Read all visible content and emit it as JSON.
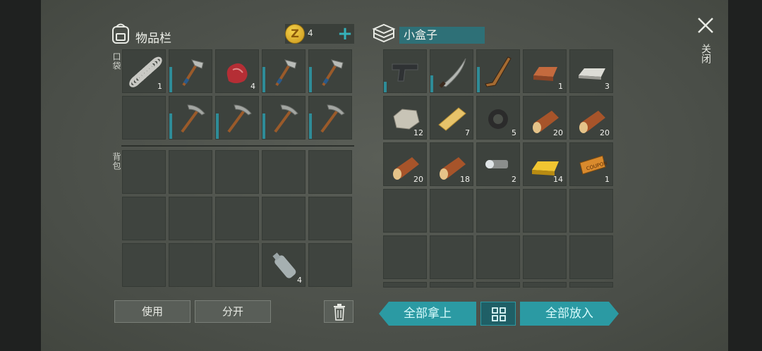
{
  "inventory": {
    "title": "物品栏",
    "pocket_label": "口袋",
    "backpack_label": "背包",
    "coins": "4",
    "pocket": [
      {
        "icon": "spring-icon",
        "qty": "1",
        "dur": 0
      },
      {
        "icon": "hammer-icon",
        "qty": "",
        "dur": 0.6
      },
      {
        "icon": "meat-icon",
        "qty": "4",
        "dur": 0
      },
      {
        "icon": "hammer-icon",
        "qty": "",
        "dur": 0.6
      },
      {
        "icon": "hammer-icon",
        "qty": "",
        "dur": 0.6
      },
      {
        "icon": "",
        "qty": "",
        "dur": 0
      },
      {
        "icon": "pickaxe-icon",
        "qty": "",
        "dur": 0.6
      },
      {
        "icon": "pickaxe-icon",
        "qty": "",
        "dur": 0.6
      },
      {
        "icon": "pickaxe-icon",
        "qty": "",
        "dur": 0.6
      },
      {
        "icon": "pickaxe-icon",
        "qty": "",
        "dur": 0.6
      }
    ],
    "backpack": [
      {
        "icon": "",
        "qty": ""
      },
      {
        "icon": "",
        "qty": ""
      },
      {
        "icon": "",
        "qty": ""
      },
      {
        "icon": "",
        "qty": ""
      },
      {
        "icon": "",
        "qty": ""
      },
      {
        "icon": "",
        "qty": ""
      },
      {
        "icon": "",
        "qty": ""
      },
      {
        "icon": "",
        "qty": ""
      },
      {
        "icon": "",
        "qty": ""
      },
      {
        "icon": "",
        "qty": ""
      },
      {
        "icon": "",
        "qty": ""
      },
      {
        "icon": "",
        "qty": ""
      },
      {
        "icon": "",
        "qty": ""
      },
      {
        "icon": "bottle-icon",
        "qty": "4"
      },
      {
        "icon": "",
        "qty": ""
      }
    ],
    "use_label": "使用",
    "split_label": "分开"
  },
  "container": {
    "name": "小盒子",
    "items": [
      {
        "icon": "pistol-icon",
        "qty": "",
        "dur": 0.25
      },
      {
        "icon": "machete-icon",
        "qty": "",
        "dur": 0.4
      },
      {
        "icon": "hockey-stick-icon",
        "qty": "",
        "dur": 0.6
      },
      {
        "icon": "copper-ingot-icon",
        "qty": "1",
        "dur": 0
      },
      {
        "icon": "silver-ingot-icon",
        "qty": "3",
        "dur": 0
      },
      {
        "icon": "stone-icon",
        "qty": "12",
        "dur": 0
      },
      {
        "icon": "plank-icon",
        "qty": "7",
        "dur": 0
      },
      {
        "icon": "rubber-parts-icon",
        "qty": "5",
        "dur": 0
      },
      {
        "icon": "log-icon",
        "qty": "20",
        "dur": 0
      },
      {
        "icon": "log-icon",
        "qty": "20",
        "dur": 0
      },
      {
        "icon": "log-icon",
        "qty": "20",
        "dur": 0
      },
      {
        "icon": "log-icon",
        "qty": "18",
        "dur": 0
      },
      {
        "icon": "flashlight-icon",
        "qty": "2",
        "dur": 0
      },
      {
        "icon": "gold-ingot-icon",
        "qty": "14",
        "dur": 0
      },
      {
        "icon": "coupon-icon",
        "qty": "1",
        "dur": 0
      }
    ],
    "take_all_label": "全部拿上",
    "put_all_label": "全部放入"
  },
  "close_label": "关闭",
  "colors": {
    "accent": "#2b9aa3",
    "durability": "#2e8c98",
    "name_bg": "#2e7077"
  }
}
